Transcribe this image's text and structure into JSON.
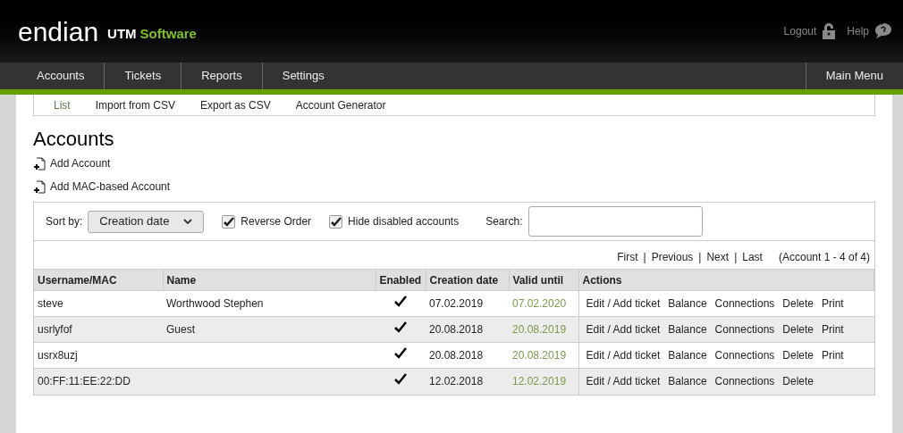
{
  "header": {
    "logo": "endian",
    "product": "UTM",
    "product_suffix": "Software",
    "links": [
      {
        "label": "Logout",
        "kind": "lock"
      },
      {
        "label": "Help",
        "kind": "help"
      }
    ]
  },
  "nav": {
    "items": [
      "Accounts",
      "Tickets",
      "Reports",
      "Settings"
    ],
    "right": "Main Menu"
  },
  "subnav": [
    {
      "label": "List",
      "selected": true
    },
    {
      "label": "Import from CSV",
      "selected": false
    },
    {
      "label": "Export as CSV",
      "selected": false
    },
    {
      "label": "Account Generator",
      "selected": false
    }
  ],
  "title": "Accounts",
  "add_links": [
    "Add Account",
    "Add MAC-based Account"
  ],
  "filters": {
    "sort_label": "Sort by:",
    "sort_value": "Creation date",
    "checkboxes": [
      {
        "label": "Reverse Order",
        "checked": true
      },
      {
        "label": "Hide disabled accounts",
        "checked": true
      }
    ],
    "search_label": "Search:"
  },
  "pager": {
    "separator": "|",
    "links": [
      "First",
      "Previous",
      "Next",
      "Last"
    ],
    "summary": "(Account 1 - 4 of 4)"
  },
  "table": {
    "columns": [
      "Username/MAC",
      "Name",
      "Enabled",
      "Creation date",
      "Valid until",
      "Actions"
    ],
    "rows": [
      {
        "username": "steve",
        "name": "Worthwood Stephen",
        "enabled": true,
        "created": "07.02.2019",
        "valid": "07.02.2020",
        "actions": [
          "Edit / Add ticket",
          "Balance",
          "Connections",
          "Delete",
          "Print"
        ]
      },
      {
        "username": "usrlyfof",
        "name": "Guest",
        "enabled": true,
        "created": "20.08.2018",
        "valid": "20.08.2019",
        "actions": [
          "Edit / Add ticket",
          "Balance",
          "Connections",
          "Delete",
          "Print"
        ]
      },
      {
        "username": "usrx8uzj",
        "enabled": true,
        "created": "20.08.2018",
        "valid": "20.08.2019",
        "actions": [
          "Edit / Add ticket",
          "Balance",
          "Connections",
          "Delete",
          "Print"
        ]
      },
      {
        "username": "00:FF:11:EE:22:DD",
        "enabled": true,
        "created": "12.02.2018",
        "valid": "12.02.2019",
        "actions": [
          "Edit / Add ticket",
          "Balance",
          "Connections",
          "Delete"
        ]
      }
    ]
  }
}
